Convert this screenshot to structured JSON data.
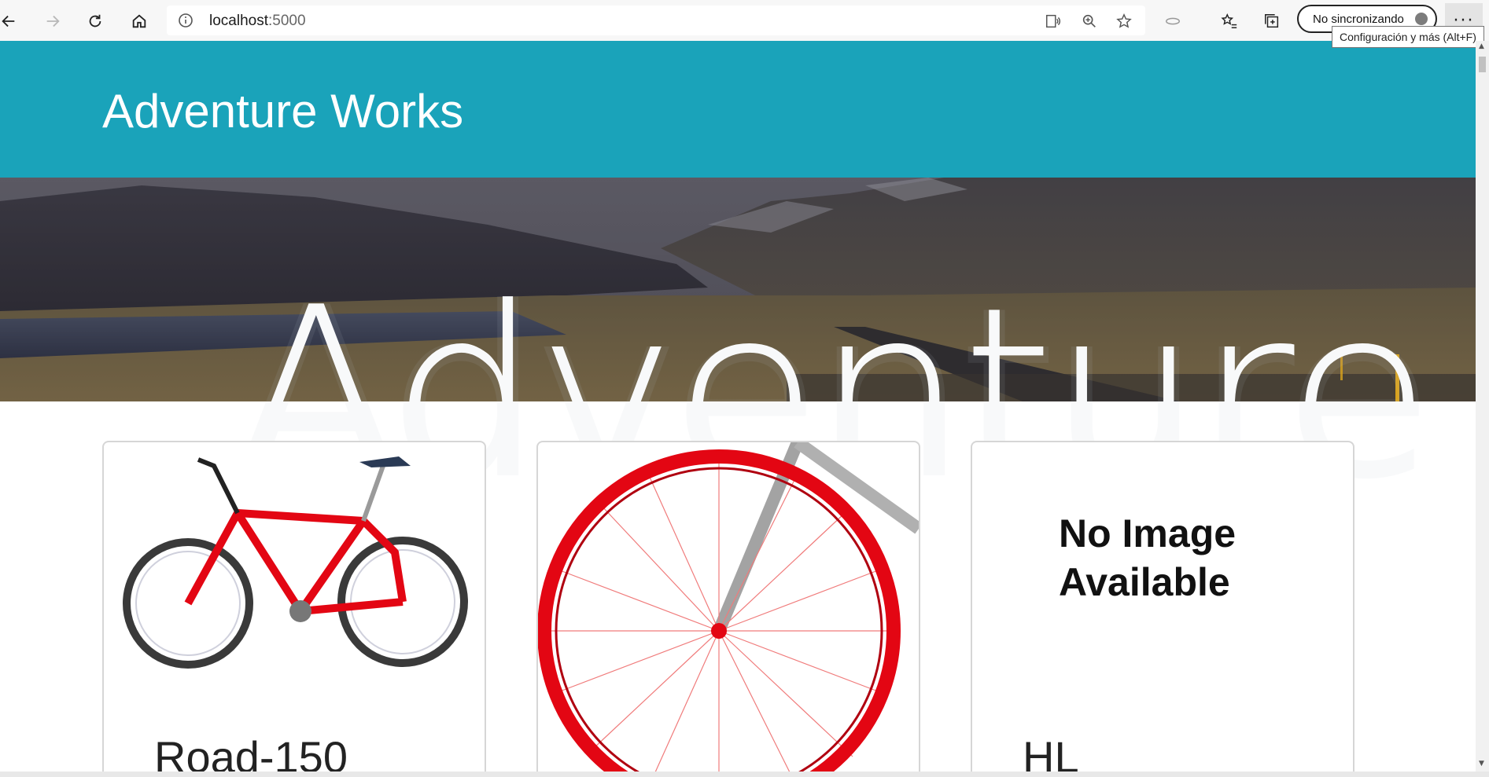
{
  "browser": {
    "url_host": "localhost",
    "url_port": ":5000",
    "sync_label": "No sincronizando",
    "more_label": "···",
    "tooltip": "Configuración y más (Alt+F)"
  },
  "page": {
    "brand": "Adventure Works",
    "hero_watermark": "Adventure",
    "cards": [
      {
        "title": "Road-150",
        "image": "red-bike-image"
      },
      {
        "title": "",
        "image": "red-wheel-image"
      },
      {
        "title": "HL",
        "image": "no-image",
        "no_image_text_1": "No Image",
        "no_image_text_2": "Available"
      }
    ]
  },
  "colors": {
    "header_bg": "#1aa3ba",
    "bike_red": "#e30613"
  }
}
